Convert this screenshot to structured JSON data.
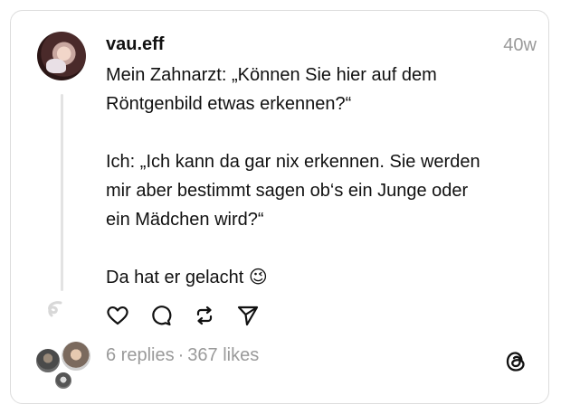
{
  "post": {
    "username": "vau.eff",
    "time": "40w",
    "text": "Mein Zahnarzt: „Können Sie hier auf dem\nRöntgenbild etwas erkennen?“\n\nIch: „Ich kann da gar nix erkennen. Sie werden\nmir aber bestimmt sagen ob‘s ein Junge oder\nein Mädchen wird?“\n\nDa hat er gelacht 😉"
  },
  "actions": {
    "icons": [
      "heart-icon",
      "comment-icon",
      "repost-icon",
      "share-icon"
    ]
  },
  "stats": {
    "replies": "6 replies",
    "separator": "·",
    "likes": "367 likes"
  },
  "colors": {
    "text": "#111111",
    "muted": "#9a9a9a",
    "border": "#dcdcdc"
  }
}
